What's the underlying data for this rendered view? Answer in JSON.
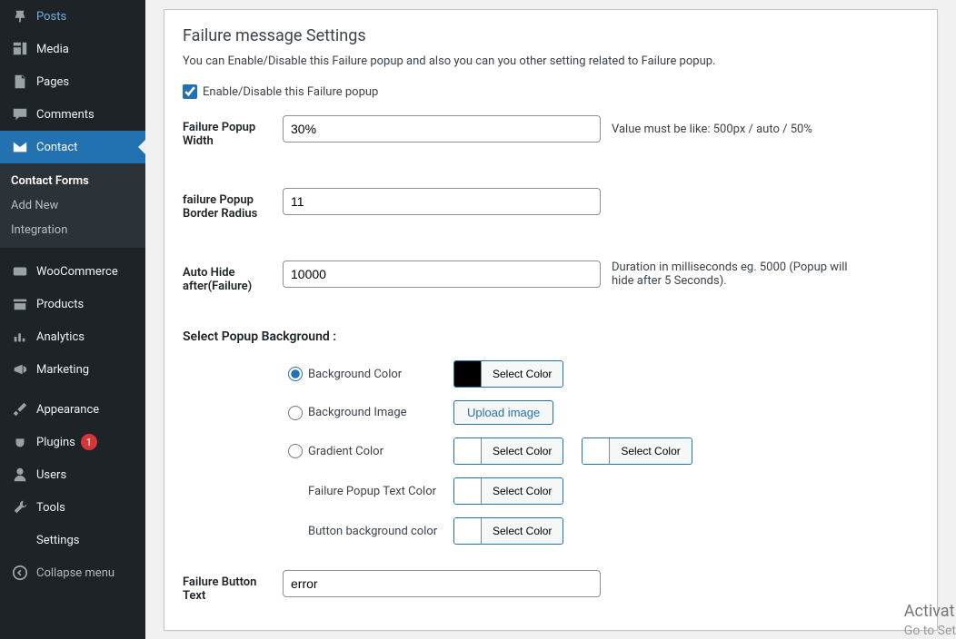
{
  "sidebar": {
    "items": [
      {
        "label": "Posts"
      },
      {
        "label": "Media"
      },
      {
        "label": "Pages"
      },
      {
        "label": "Comments"
      },
      {
        "label": "Contact"
      },
      {
        "label": "WooCommerce"
      },
      {
        "label": "Products"
      },
      {
        "label": "Analytics"
      },
      {
        "label": "Marketing"
      },
      {
        "label": "Appearance"
      },
      {
        "label": "Plugins"
      },
      {
        "label": "Users"
      },
      {
        "label": "Tools"
      },
      {
        "label": "Settings"
      }
    ],
    "submenu": [
      {
        "label": "Contact Forms"
      },
      {
        "label": "Add New"
      },
      {
        "label": "Integration"
      }
    ],
    "plugins_badge": "1",
    "collapse_label": "Collapse menu"
  },
  "section": {
    "title": "Failure message Settings",
    "description": "You can Enable/Disable this Failure popup and also you can you other setting related to Failure popup."
  },
  "form": {
    "enable_checkbox_label": "Enable/Disable this Failure popup",
    "enable_checked": true,
    "width_label": "Failure Popup Width",
    "width_value": "30%",
    "width_hint": "Value must be like: 500px / auto / 50%",
    "radius_label": "failure Popup Border Radius",
    "radius_value": "11",
    "hide_label": "Auto Hide after(Failure)",
    "hide_value": "10000",
    "hide_hint": "Duration in milliseconds eg. 5000 (Popup will hide after 5 Seconds).",
    "bg_section_label": "Select Popup Background :",
    "radio_bg_color": "Background Color",
    "radio_bg_image": "Background Image",
    "radio_gradient": "Gradient Color",
    "text_color_label": "Failure Popup Text Color",
    "button_bg_label": "Button background color",
    "select_color_btn": "Select Color",
    "upload_btn": "Upload image",
    "bg_color_value": "#000000",
    "button_text_label": "Failure Button Text",
    "button_text_value": "error"
  },
  "watermark": {
    "line1": "Activat",
    "line2": "Go to Set"
  }
}
